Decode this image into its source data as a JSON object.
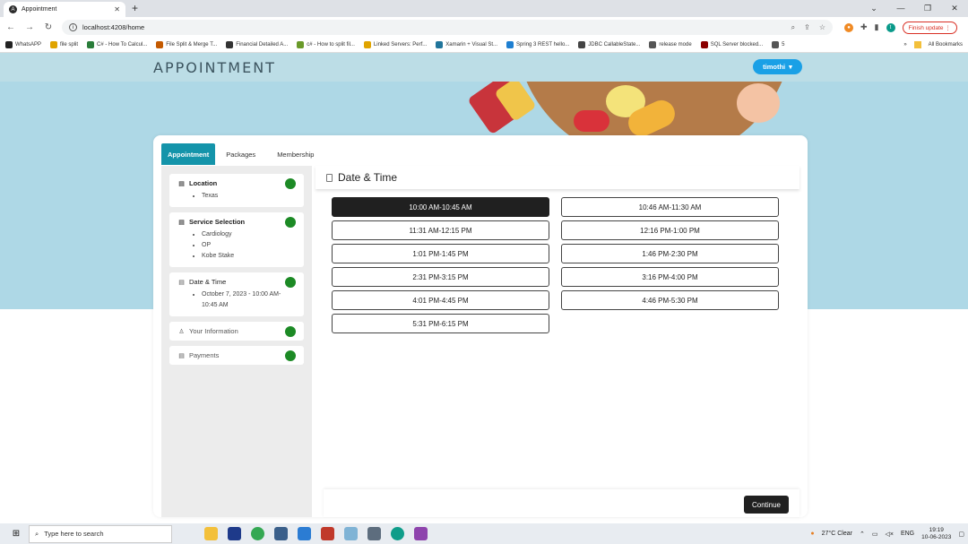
{
  "browser": {
    "tab_title": "Appointment",
    "url": "localhost:4208/home",
    "finish_update": "Finish update",
    "profile_initial": "t",
    "bookmarks": [
      "WhatsAPP",
      "file split",
      "C# - How To Calcul...",
      "File Split & Merge T...",
      "Financial Detailed A...",
      "c# - How to split fil...",
      "Linked Servers: Perf...",
      "Xamarin + Visual St...",
      "Spring 3 REST hello...",
      "JDBC CallableState...",
      "release mode",
      "SQL Server blocked...",
      "5"
    ],
    "all_bookmarks": "All Bookmarks"
  },
  "app": {
    "brand": "APPOINTMENT",
    "user": "timothi"
  },
  "tabs": [
    "Appointment",
    "Packages",
    "Membership"
  ],
  "steps": {
    "location": {
      "title": "Location",
      "items": [
        "Texas"
      ]
    },
    "service": {
      "title": "Service Selection",
      "items": [
        "Cardiology",
        "OP",
        "Kobe Stake"
      ]
    },
    "datetime": {
      "title": "Date & Time",
      "items": [
        "October 7, 2023 - 10:00 AM-10:45 AM"
      ]
    },
    "info": {
      "title": "Your Information"
    },
    "payments": {
      "title": "Payments"
    }
  },
  "main": {
    "title": "Date & Time",
    "slots": [
      "10:00 AM-10:45 AM",
      "10:46 AM-11:30 AM",
      "11:31 AM-12:15 PM",
      "12:16 PM-1:00 PM",
      "1:01 PM-1:45 PM",
      "1:46 PM-2:30 PM",
      "2:31 PM-3:15 PM",
      "3:16 PM-4:00 PM",
      "4:01 PM-4:45 PM",
      "4:46 PM-5:30 PM",
      "5:31 PM-6:15 PM"
    ],
    "selected_slot": "10:00 AM-10:45 AM",
    "continue_label": "Continue"
  },
  "taskbar": {
    "search_placeholder": "Type here to search",
    "weather": "27°C  Clear",
    "lang": "ENG",
    "time": "19:19",
    "date": "10-06-2023"
  },
  "colors": {
    "brand_teal": "#1494aa",
    "user_blue": "#1aa0e6",
    "status_green": "#1c8a25",
    "selected_dark": "#202020"
  }
}
